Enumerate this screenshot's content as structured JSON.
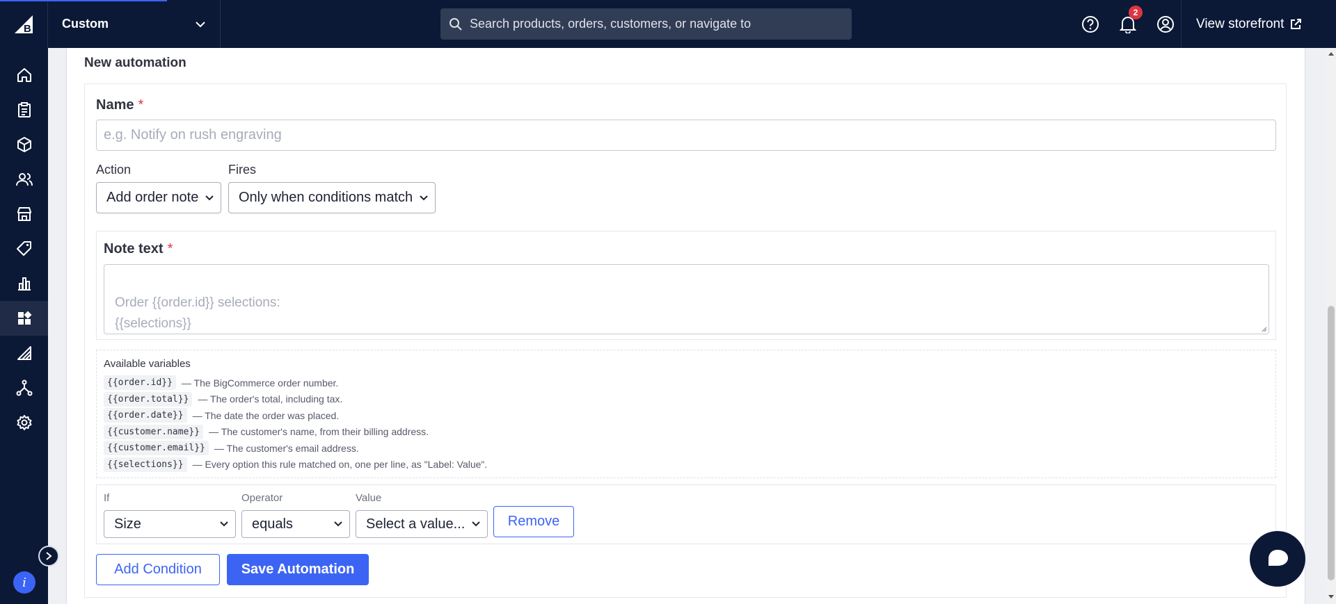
{
  "topbar": {
    "store_name": "Custom",
    "search_placeholder": "Search products, orders, customers, or navigate to",
    "notification_count": "2",
    "view_storefront_label": "View storefront"
  },
  "sidebar": {
    "items": [
      {
        "icon": "home-icon"
      },
      {
        "icon": "orders-icon"
      },
      {
        "icon": "products-icon"
      },
      {
        "icon": "customers-icon"
      },
      {
        "icon": "storefront-icon"
      },
      {
        "icon": "marketing-icon"
      },
      {
        "icon": "analytics-icon"
      },
      {
        "icon": "apps-icon",
        "active": true
      },
      {
        "icon": "channels-icon"
      },
      {
        "icon": "integrations-icon"
      },
      {
        "icon": "settings-icon"
      }
    ]
  },
  "card": {
    "title": "New automation"
  },
  "form": {
    "name_label": "Name",
    "required_mark": "*",
    "name_placeholder": "e.g. Notify on rush engraving",
    "action_label": "Action",
    "action_value": "Add order note",
    "fires_label": "Fires",
    "fires_value": "Only when conditions match",
    "note_label": "Note text",
    "note_placeholder": "Order {{order.id}} selections:\n{{selections}}"
  },
  "variables": {
    "title": "Available variables",
    "items": [
      {
        "code": "{{order.id}}",
        "desc": "— The BigCommerce order number."
      },
      {
        "code": "{{order.total}}",
        "desc": "— The order's total, including tax."
      },
      {
        "code": "{{order.date}}",
        "desc": "— The date the order was placed."
      },
      {
        "code": "{{customer.name}}",
        "desc": "— The customer's name, from their billing address."
      },
      {
        "code": "{{customer.email}}",
        "desc": "— The customer's email address."
      },
      {
        "code": "{{selections}}",
        "desc": "— Every option this rule matched on, one per line, as \"Label: Value\"."
      }
    ]
  },
  "condition": {
    "if_label": "If",
    "if_value": "Size",
    "operator_label": "Operator",
    "operator_value": "equals",
    "value_label": "Value",
    "value_value": "Select a value...",
    "remove_label": "Remove"
  },
  "buttons": {
    "add_condition": "Add Condition",
    "save_automation": "Save Automation"
  },
  "colors": {
    "nav_bg": "#0b1936",
    "accent": "#3c64f4",
    "danger": "#db3643"
  }
}
